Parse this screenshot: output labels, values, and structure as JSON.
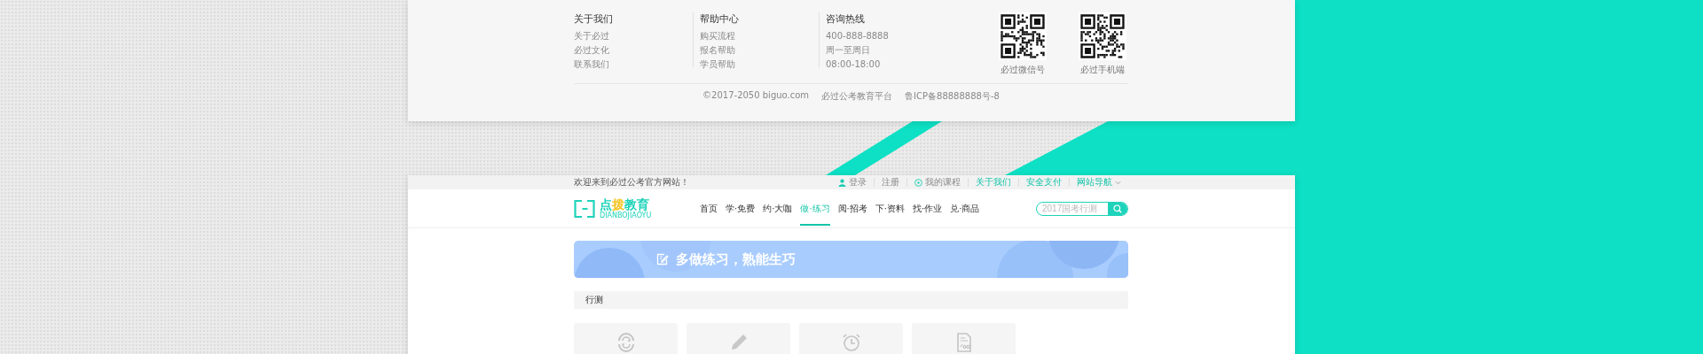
{
  "footer": {
    "columns": [
      {
        "title": "关于我们",
        "links": [
          "关于必过",
          "必过文化",
          "联系我们"
        ]
      },
      {
        "title": "帮助中心",
        "links": [
          "购买流程",
          "报名帮助",
          "学员帮助"
        ]
      },
      {
        "title": "咨询热线",
        "links": [
          "400-888-8888",
          "周一至周日",
          "08:00-18:00"
        ]
      }
    ],
    "qr_codes": [
      {
        "caption": "必过微信号"
      },
      {
        "caption": "必过手机端"
      }
    ],
    "copyright": [
      "©2017-2050 biguo.com",
      "必过公考教育平台",
      "鲁ICP备88888888号-8"
    ]
  },
  "top_bar": {
    "welcome": "欢迎来到必过公考官方网站！",
    "links": [
      {
        "label": "登录",
        "kind": "user"
      },
      {
        "label": "注册",
        "kind": "plain"
      },
      {
        "label": "我的课程",
        "kind": "play"
      },
      {
        "label": "关于我们",
        "kind": "accent"
      },
      {
        "label": "安全支付",
        "kind": "accent"
      },
      {
        "label": "网站导航",
        "kind": "menu"
      }
    ]
  },
  "logo": {
    "parts": [
      {
        "text": "点",
        "color": "#1ed3b9"
      },
      {
        "text": "拨",
        "color": "#f5c21b"
      },
      {
        "text": "教育",
        "color": "#1ed3b9"
      }
    ],
    "subtitle": "DIANBOJIAOYU"
  },
  "nav": [
    {
      "label": "首页",
      "selected": false
    },
    {
      "label": "学·免费",
      "selected": false
    },
    {
      "label": "约·大咖",
      "selected": false
    },
    {
      "label": "做·练习",
      "selected": true
    },
    {
      "label": "阅·招考",
      "selected": false
    },
    {
      "label": "下·资料",
      "selected": false
    },
    {
      "label": "找·作业",
      "selected": false
    },
    {
      "label": "兑·商品",
      "selected": false
    }
  ],
  "search": {
    "placeholder": "2017国考行测"
  },
  "banner": {
    "title": "多做练习，熟能生巧"
  },
  "section": {
    "title": "行测"
  },
  "practice_cards": [
    {
      "kind": "cycle"
    },
    {
      "kind": "pencil"
    },
    {
      "kind": "alarm"
    },
    {
      "kind": "paper"
    }
  ]
}
